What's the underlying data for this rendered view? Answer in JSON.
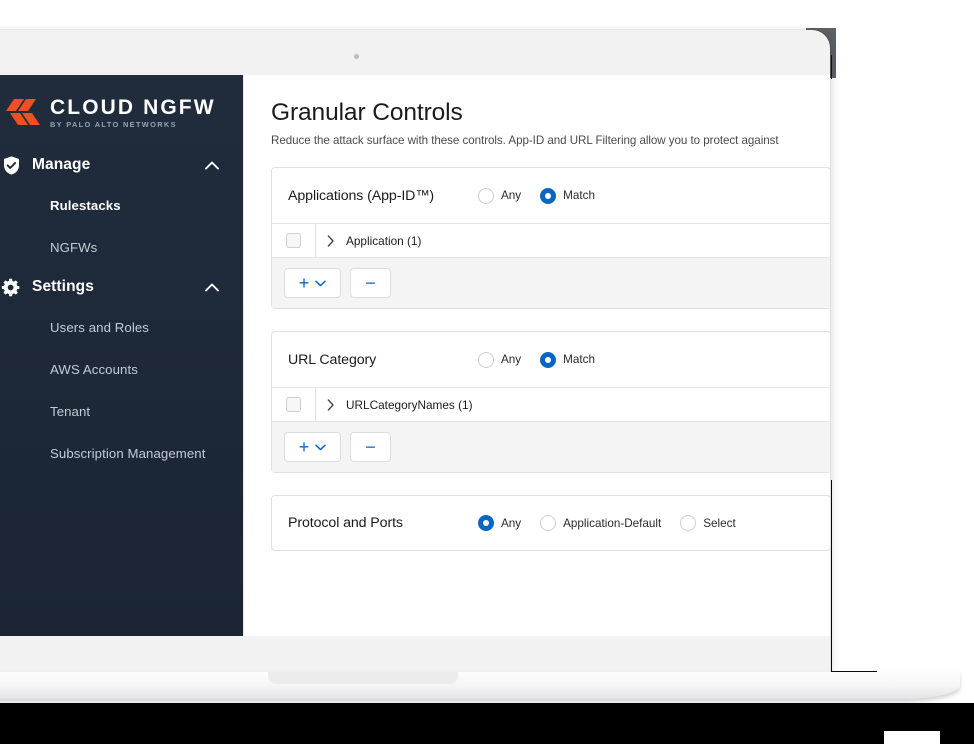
{
  "device": {
    "type": "laptop-mockup",
    "camera_dot": "camera-dot"
  },
  "brand": {
    "name": "CLOUD NGFW",
    "tagline": "BY PALO ALTO NETWORKS",
    "logo_color": "#f04e23"
  },
  "sidebar": {
    "background": "#1d2939",
    "groups": [
      {
        "id": "manage",
        "label": "Manage",
        "icon": "shield-check-icon",
        "caret": "chevron-up-icon",
        "expanded": true,
        "items": [
          {
            "label": "Rulestacks",
            "active": true
          },
          {
            "label": "NGFWs",
            "active": false
          }
        ]
      },
      {
        "id": "settings",
        "label": "Settings",
        "icon": "gear-icon",
        "caret": "chevron-up-icon",
        "expanded": true,
        "items": [
          {
            "label": "Users and Roles",
            "active": false
          },
          {
            "label": "AWS Accounts",
            "active": false
          },
          {
            "label": "Tenant",
            "active": false
          },
          {
            "label": "Subscription Management",
            "active": false
          }
        ]
      }
    ]
  },
  "main": {
    "title": "Granular Controls",
    "subtitle": "Reduce the attack surface with these controls. App-ID and URL Filtering allow you to protect against",
    "accent_color": "#0a66c2",
    "cards": [
      {
        "id": "applications",
        "title": "Applications (App-ID™)",
        "options": [
          {
            "label": "Any",
            "selected": false
          },
          {
            "label": "Match",
            "selected": true
          }
        ],
        "table": {
          "has_checkbox": true,
          "expand_icon": "chevron-right-icon",
          "column_label": "Application (1)"
        },
        "footer": {
          "add_label": "+",
          "add_caret": "chevron-down-icon",
          "remove_label": "−"
        }
      },
      {
        "id": "url-category",
        "title": "URL Category",
        "options": [
          {
            "label": "Any",
            "selected": false
          },
          {
            "label": "Match",
            "selected": true
          }
        ],
        "table": {
          "has_checkbox": true,
          "expand_icon": "chevron-right-icon",
          "column_label": "URLCategoryNames (1)"
        },
        "footer": {
          "add_label": "+",
          "add_caret": "chevron-down-icon",
          "remove_label": "−"
        }
      },
      {
        "id": "protocol-and-ports",
        "title": "Protocol and Ports",
        "options": [
          {
            "label": "Any",
            "selected": true
          },
          {
            "label": "Application-Default",
            "selected": false
          },
          {
            "label": "Select",
            "selected": false
          }
        ],
        "table": null,
        "footer": null
      }
    ]
  }
}
